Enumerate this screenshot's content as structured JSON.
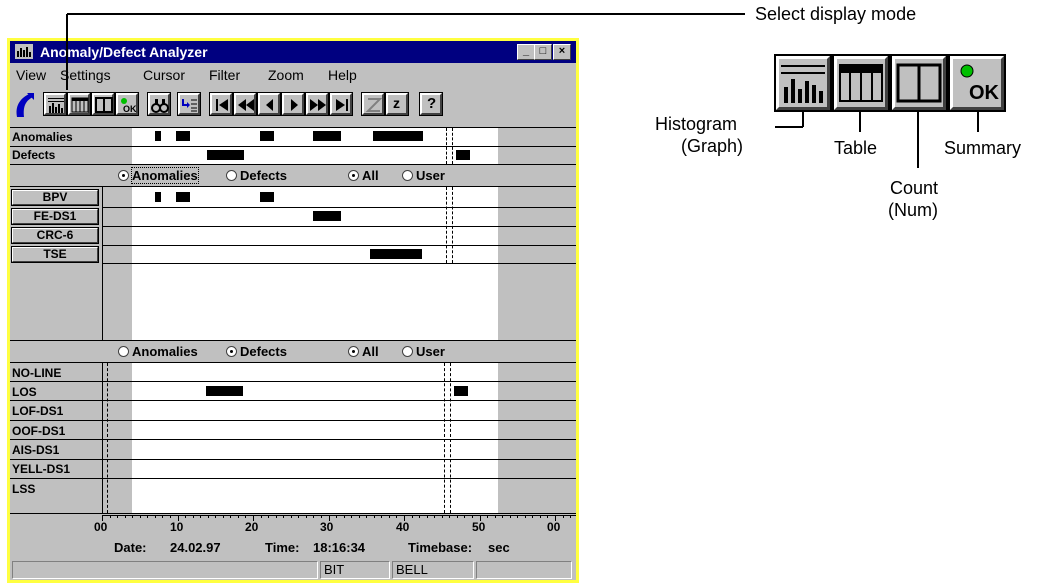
{
  "window": {
    "title": "Anomaly/Defect Analyzer",
    "menu": [
      "View",
      "Settings",
      "Cursor",
      "Filter",
      "Zoom",
      "Help"
    ],
    "toolbar_icons": [
      "analyzer-logo-icon",
      "histogram-icon",
      "table-icon",
      "count-icon",
      "summary-ok-icon",
      "binoculars-icon",
      "list-jump-icon",
      "goto-start-icon",
      "fast-back-icon",
      "step-back-icon",
      "step-forward-icon",
      "fast-forward-icon",
      "goto-end-icon",
      "zoom-out-icon",
      "zoom-in-icon",
      "help-icon"
    ],
    "zoom_in_label": "z",
    "help_label": "?"
  },
  "summary_panel": {
    "rows": [
      "Anomalies",
      "Defects"
    ]
  },
  "anomaly_panel": {
    "radios": [
      {
        "label": "Anomalies",
        "selected": true
      },
      {
        "label": "Defects",
        "selected": false
      },
      {
        "label": "All",
        "selected": true
      },
      {
        "label": "User",
        "selected": false
      }
    ],
    "channels": [
      "BPV",
      "FE-DS1",
      "CRC-6",
      "TSE"
    ]
  },
  "defect_panel": {
    "radios": [
      {
        "label": "Anomalies",
        "selected": false
      },
      {
        "label": "Defects",
        "selected": true
      },
      {
        "label": "All",
        "selected": true
      },
      {
        "label": "User",
        "selected": false
      }
    ],
    "channels": [
      "NO-LINE",
      "LOS",
      "LOF-DS1",
      "OOF-DS1",
      "AIS-DS1",
      "YELL-DS1",
      "LSS"
    ]
  },
  "axis": {
    "ticks": [
      "00",
      "10",
      "20",
      "30",
      "40",
      "50",
      "00"
    ],
    "date_label": "Date:",
    "date": "24.02.97",
    "time_label": "Time:",
    "time": "18:16:34",
    "timebase_label": "Timebase:",
    "timebase": "sec"
  },
  "statusbar": [
    "",
    "BIT",
    "BELL",
    ""
  ],
  "callout": {
    "title": "Select display mode",
    "histogram": [
      "Histogram",
      "(Graph)"
    ],
    "table": "Table",
    "count": [
      "Count",
      "(Num)"
    ],
    "summary": "Summary",
    "ok_label": "OK"
  }
}
